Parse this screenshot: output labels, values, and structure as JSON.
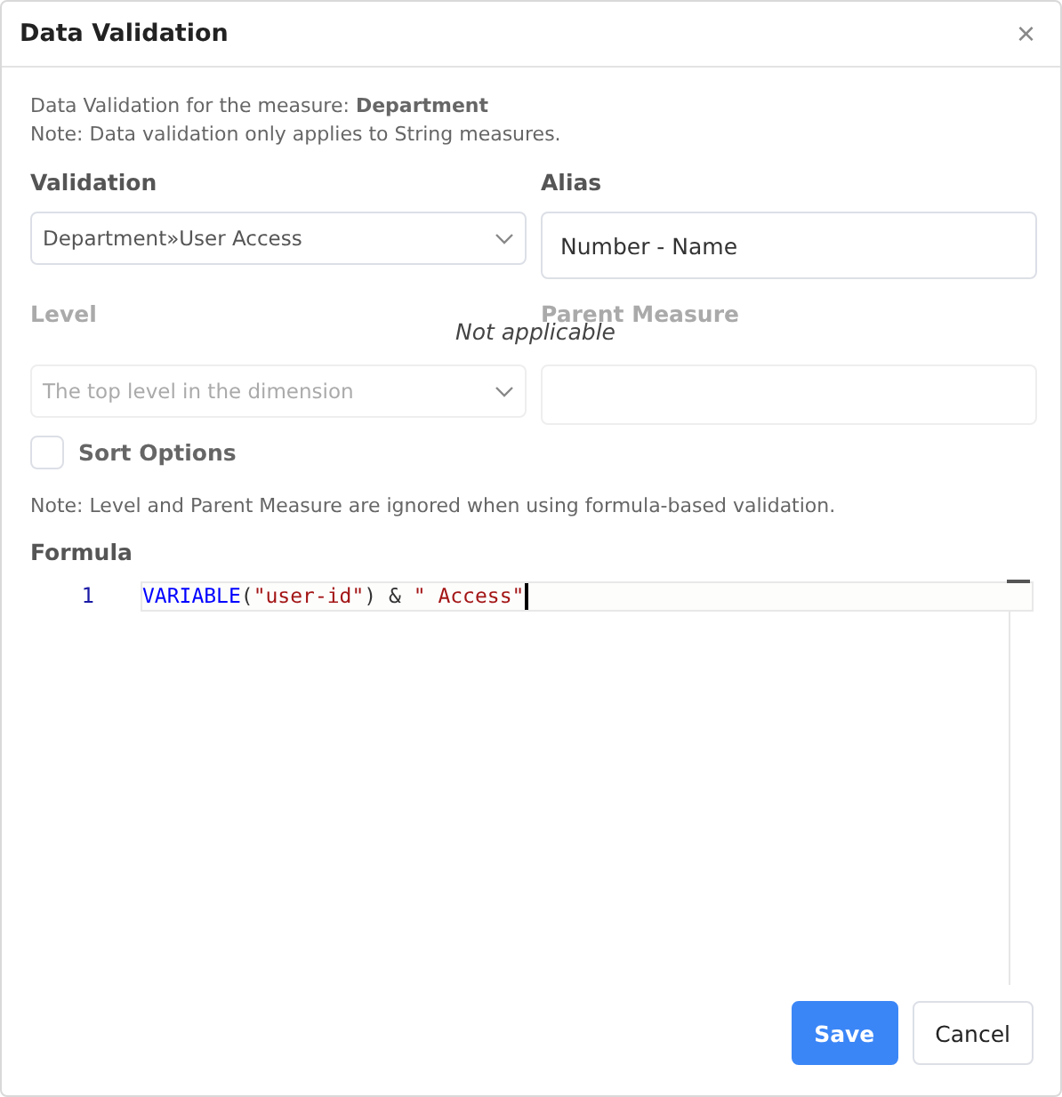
{
  "window": {
    "title": "Data Validation",
    "close": "×"
  },
  "intro": {
    "line1": "Data Validation for the measure: **Department**",
    "line2": "Note: Data validation only applies to String measures."
  },
  "validation": {
    "label": "Validation",
    "value": "Department»User Access",
    "disabled": false
  },
  "alias": {
    "label": "Alias",
    "value": "Number - Name",
    "disabled": false
  },
  "level": {
    "label": "Level",
    "value": "The top level in the dimension",
    "disabled": true
  },
  "parent_measure": {
    "label": "Parent Measure",
    "disabled": true
  },
  "overlay_note": "Not applicable",
  "sort_options": {
    "label": "Sort Options",
    "checked": false
  },
  "formula_note": "Note: Level and Parent Measure are ignored when using formula-based validation.",
  "formula": {
    "label": "Formula",
    "lines": [
      {
        "number": "1",
        "tokens": [
          {
            "kind": "function",
            "text": "VARIABLE"
          },
          {
            "kind": "punct",
            "text": "("
          },
          {
            "kind": "string",
            "text": "\"user-id\""
          },
          {
            "kind": "punct",
            "text": ")"
          },
          {
            "kind": "operator",
            "text": " & "
          },
          {
            "kind": "string",
            "text": "\" Access\""
          }
        ]
      }
    ]
  },
  "buttons": [
    {
      "label": "Save",
      "kind": "primary"
    },
    {
      "label": "Cancel",
      "kind": "secondary"
    }
  ]
}
